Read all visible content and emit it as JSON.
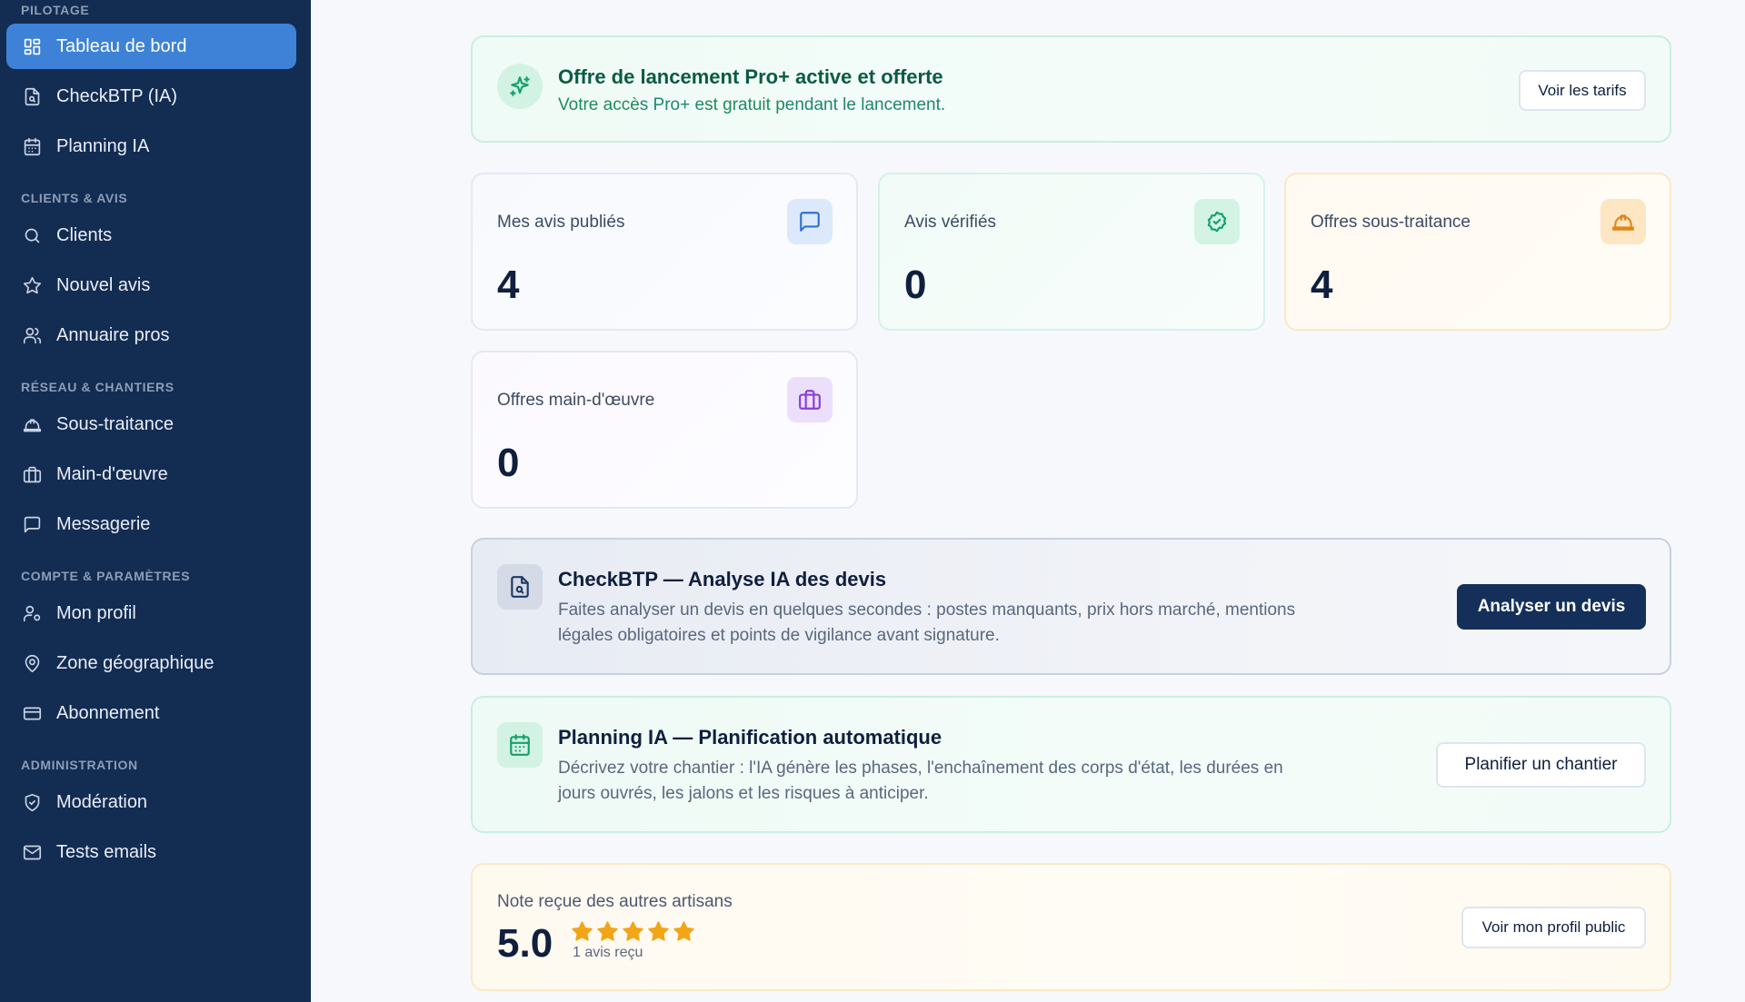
{
  "sidebar": {
    "sections": [
      {
        "label": "PILOTAGE"
      },
      {
        "label": "CLIENTS & AVIS"
      },
      {
        "label": "RÉSEAU & CHANTIERS"
      },
      {
        "label": "COMPTE & PARAMÈTRES"
      },
      {
        "label": "ADMINISTRATION"
      }
    ],
    "items": [
      {
        "label": "Tableau de bord",
        "icon": "dashboard-icon",
        "active": true
      },
      {
        "label": "CheckBTP (IA)",
        "icon": "file-search-icon"
      },
      {
        "label": "Planning IA",
        "icon": "calendar-icon"
      },
      {
        "label": "Clients",
        "icon": "search-icon"
      },
      {
        "label": "Nouvel avis",
        "icon": "star-icon"
      },
      {
        "label": "Annuaire pros",
        "icon": "users-icon"
      },
      {
        "label": "Sous-traitance",
        "icon": "hard-hat-icon"
      },
      {
        "label": "Main-d'œuvre",
        "icon": "briefcase-icon"
      },
      {
        "label": "Messagerie",
        "icon": "message-icon"
      },
      {
        "label": "Mon profil",
        "icon": "user-cog-icon"
      },
      {
        "label": "Zone géographique",
        "icon": "map-pin-icon"
      },
      {
        "label": "Abonnement",
        "icon": "credit-card-icon"
      },
      {
        "label": "Modération",
        "icon": "shield-check-icon"
      },
      {
        "label": "Tests emails",
        "icon": "mail-icon"
      }
    ]
  },
  "promo": {
    "title": "Offre de lancement Pro+ active et offerte",
    "subtitle": "Votre accès Pro+ est gratuit pendant le lancement.",
    "button": "Voir les tarifs",
    "icon": "sparkles-icon"
  },
  "stats": [
    {
      "label": "Mes avis publiés",
      "value": "4",
      "icon": "message-icon",
      "color": "#2f6fd6",
      "bg": "#dce9fb"
    },
    {
      "label": "Avis vérifiés",
      "value": "0",
      "icon": "badge-check-icon",
      "color": "#15a06e",
      "bg": "#d3f3e5"
    },
    {
      "label": "Offres sous-traitance",
      "value": "4",
      "icon": "hard-hat-icon",
      "color": "#e0861a",
      "bg": "#fde6c4"
    },
    {
      "label": "Offres main-d'œuvre",
      "value": "0",
      "icon": "briefcase-icon",
      "color": "#8b3fd9",
      "bg": "#ecdffc"
    }
  ],
  "checkbtp": {
    "title": "CheckBTP — Analyse IA des devis",
    "description": "Faites analyser un devis en quelques secondes : postes manquants, prix hors marché, mentions légales obligatoires et points de vigilance avant signature.",
    "button": "Analyser un devis",
    "icon": "file-search-icon"
  },
  "planning": {
    "title": "Planning IA — Planification automatique",
    "description": "Décrivez votre chantier : l'IA génère les phases, l'enchaînement des corps d'état, les durées en jours ouvrés, les jalons et les risques à anticiper.",
    "button": "Planifier un chantier",
    "icon": "calendar-icon"
  },
  "rating": {
    "label": "Note reçue des autres artisans",
    "score": "5.0",
    "stars": 5,
    "count": "1 avis reçu",
    "button": "Voir mon profil public"
  }
}
